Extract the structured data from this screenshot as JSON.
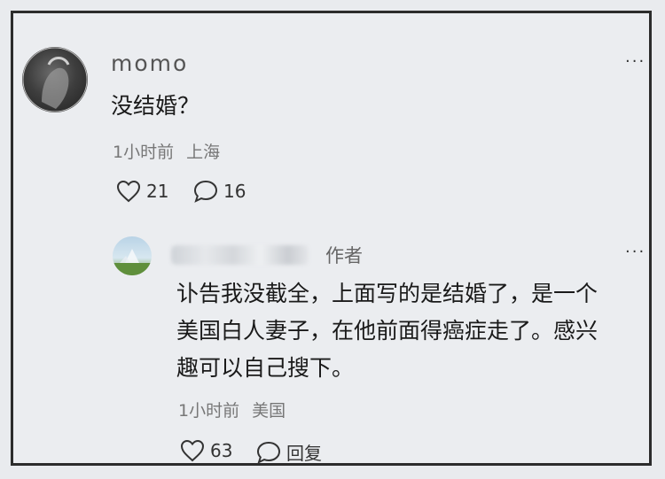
{
  "comment": {
    "username": "momo",
    "more": "···",
    "text": "没结婚？",
    "time": "1小时前",
    "location": "上海",
    "likes": "21",
    "replies": "16",
    "icons": {
      "like": "heart-outline-icon",
      "reply": "speech-bubble-icon"
    }
  },
  "reply": {
    "author_badge": "作者",
    "more": "···",
    "text_lines": [
      "讣告我没截全，上面写的是结婚了，是一个",
      "美国白人妻子，在他前面得癌症走了。感兴",
      "趣可以自己搜下。"
    ],
    "time": "1小时前",
    "location": "美国",
    "likes": "63",
    "reply_label": "回复",
    "icons": {
      "like": "heart-outline-icon",
      "reply": "speech-bubble-icon"
    }
  }
}
